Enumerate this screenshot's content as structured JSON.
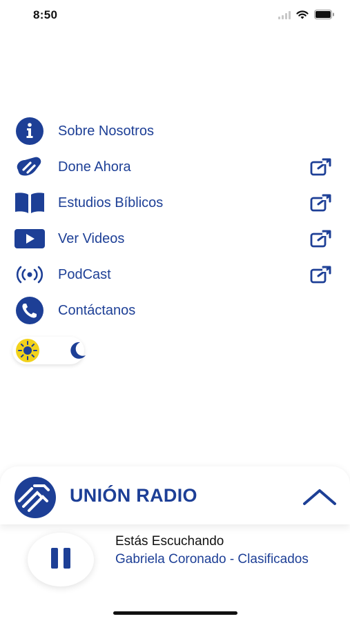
{
  "status_bar": {
    "time": "8:50"
  },
  "menu": {
    "items": [
      {
        "label": "Sobre Nosotros",
        "icon": "info-icon",
        "external": false
      },
      {
        "label": "Done Ahora",
        "icon": "donate-hand-icon",
        "external": true
      },
      {
        "label": "Estudios Bíblicos",
        "icon": "book-icon",
        "external": true
      },
      {
        "label": "Ver Videos",
        "icon": "video-play-icon",
        "external": true
      },
      {
        "label": "PodCast",
        "icon": "podcast-broadcast-icon",
        "external": true
      },
      {
        "label": "Contáctanos",
        "icon": "phone-icon",
        "external": false
      }
    ]
  },
  "theme_toggle": {
    "light_icon": "sun-icon",
    "dark_icon": "moon-icon"
  },
  "player": {
    "brand_name": "UNIÓN RADIO",
    "now_playing_label": "Estás Escuchando",
    "track_title": "Gabriela Coronado - Clasificados"
  },
  "colors": {
    "accent": "#1d3f96",
    "sun": "#f2d21b",
    "background": "#ffffff"
  }
}
